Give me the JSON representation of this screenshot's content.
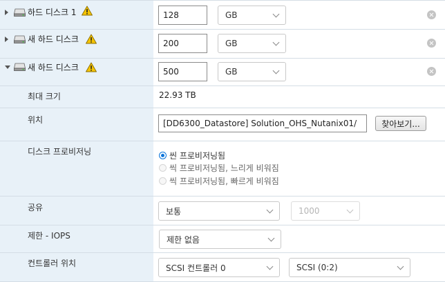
{
  "disks": [
    {
      "name": "하드 디스크 1",
      "size": "128",
      "unit": "GB"
    },
    {
      "name": "새 하드 디스크",
      "size": "200",
      "unit": "GB"
    },
    {
      "name": "새 하드 디스크",
      "size": "500",
      "unit": "GB"
    }
  ],
  "max_size": {
    "label": "최대 크기",
    "value": "22.93 TB"
  },
  "location": {
    "label": "위치",
    "value": "[DD6300_Datastore] Solution_OHS_Nutanix01/",
    "browse_label": "찾아보기..."
  },
  "provisioning": {
    "label": "디스크 프로비저닝",
    "options": [
      "씬 프로비저닝됨",
      "씩 프로비저닝됨, 느리게 비워짐",
      "씩 프로비저닝됨, 빠르게 비워짐"
    ],
    "selected_index": 0
  },
  "sharing": {
    "label": "공유",
    "value": "보통",
    "shares_value": "1000"
  },
  "limit_iops": {
    "label": "제한 - IOPS",
    "value": "제한 없음"
  },
  "controller": {
    "label": "컨트롤러 위치",
    "controller": "SCSI 컨트롤러 0",
    "slot": "SCSI (0:2)"
  },
  "colors": {
    "label_bg": "#e8f1f8",
    "accent": "#0a74da",
    "warning": "#f5c400"
  }
}
